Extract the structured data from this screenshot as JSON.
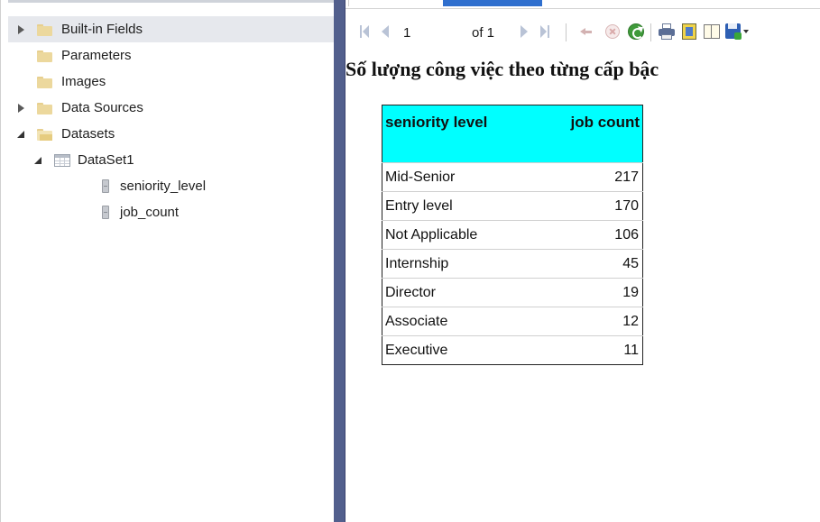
{
  "tree": {
    "items": [
      {
        "label": "Built-in Fields",
        "expander": "collapsed",
        "icon": "folder-icon",
        "selected": true
      },
      {
        "label": "Parameters",
        "expander": "none",
        "icon": "folder-icon"
      },
      {
        "label": "Images",
        "expander": "none",
        "icon": "folder-icon"
      },
      {
        "label": "Data Sources",
        "expander": "collapsed",
        "icon": "folder-icon"
      },
      {
        "label": "Datasets",
        "expander": "expanded",
        "icon": "open-folder-icon"
      },
      {
        "label": "DataSet1",
        "expander": "expanded",
        "icon": "dataset-icon"
      },
      {
        "label": "seniority_level",
        "expander": "none",
        "icon": "field-icon"
      },
      {
        "label": "job_count",
        "expander": "none",
        "icon": "field-icon"
      }
    ]
  },
  "toolbar": {
    "page_number": "1",
    "page_of": "of 1",
    "icons": [
      "first-page-icon",
      "previous-page-icon",
      "next-page-icon",
      "last-page-icon",
      "back-icon",
      "stop-icon",
      "refresh-icon",
      "print-icon",
      "print-layout-icon",
      "page-setup-icon",
      "export-icon"
    ]
  },
  "report": {
    "title": "Số lượng công việc theo từng cấp bậc",
    "columns": [
      "seniority level",
      "job count"
    ],
    "header_color": "#00ffff",
    "rows": [
      {
        "seniority_level": "Mid-Senior",
        "job_count": "217"
      },
      {
        "seniority_level": "Entry level",
        "job_count": "170"
      },
      {
        "seniority_level": "Not Applicable",
        "job_count": "106"
      },
      {
        "seniority_level": "Internship",
        "job_count": "45"
      },
      {
        "seniority_level": "Director",
        "job_count": "19"
      },
      {
        "seniority_level": "Associate",
        "job_count": "12"
      },
      {
        "seniority_level": "Executive",
        "job_count": "11"
      }
    ]
  },
  "colors": {
    "splitter": "#525f8d",
    "tab_indicator": "#2f6fce",
    "selected_row": "#e6e8ed"
  }
}
